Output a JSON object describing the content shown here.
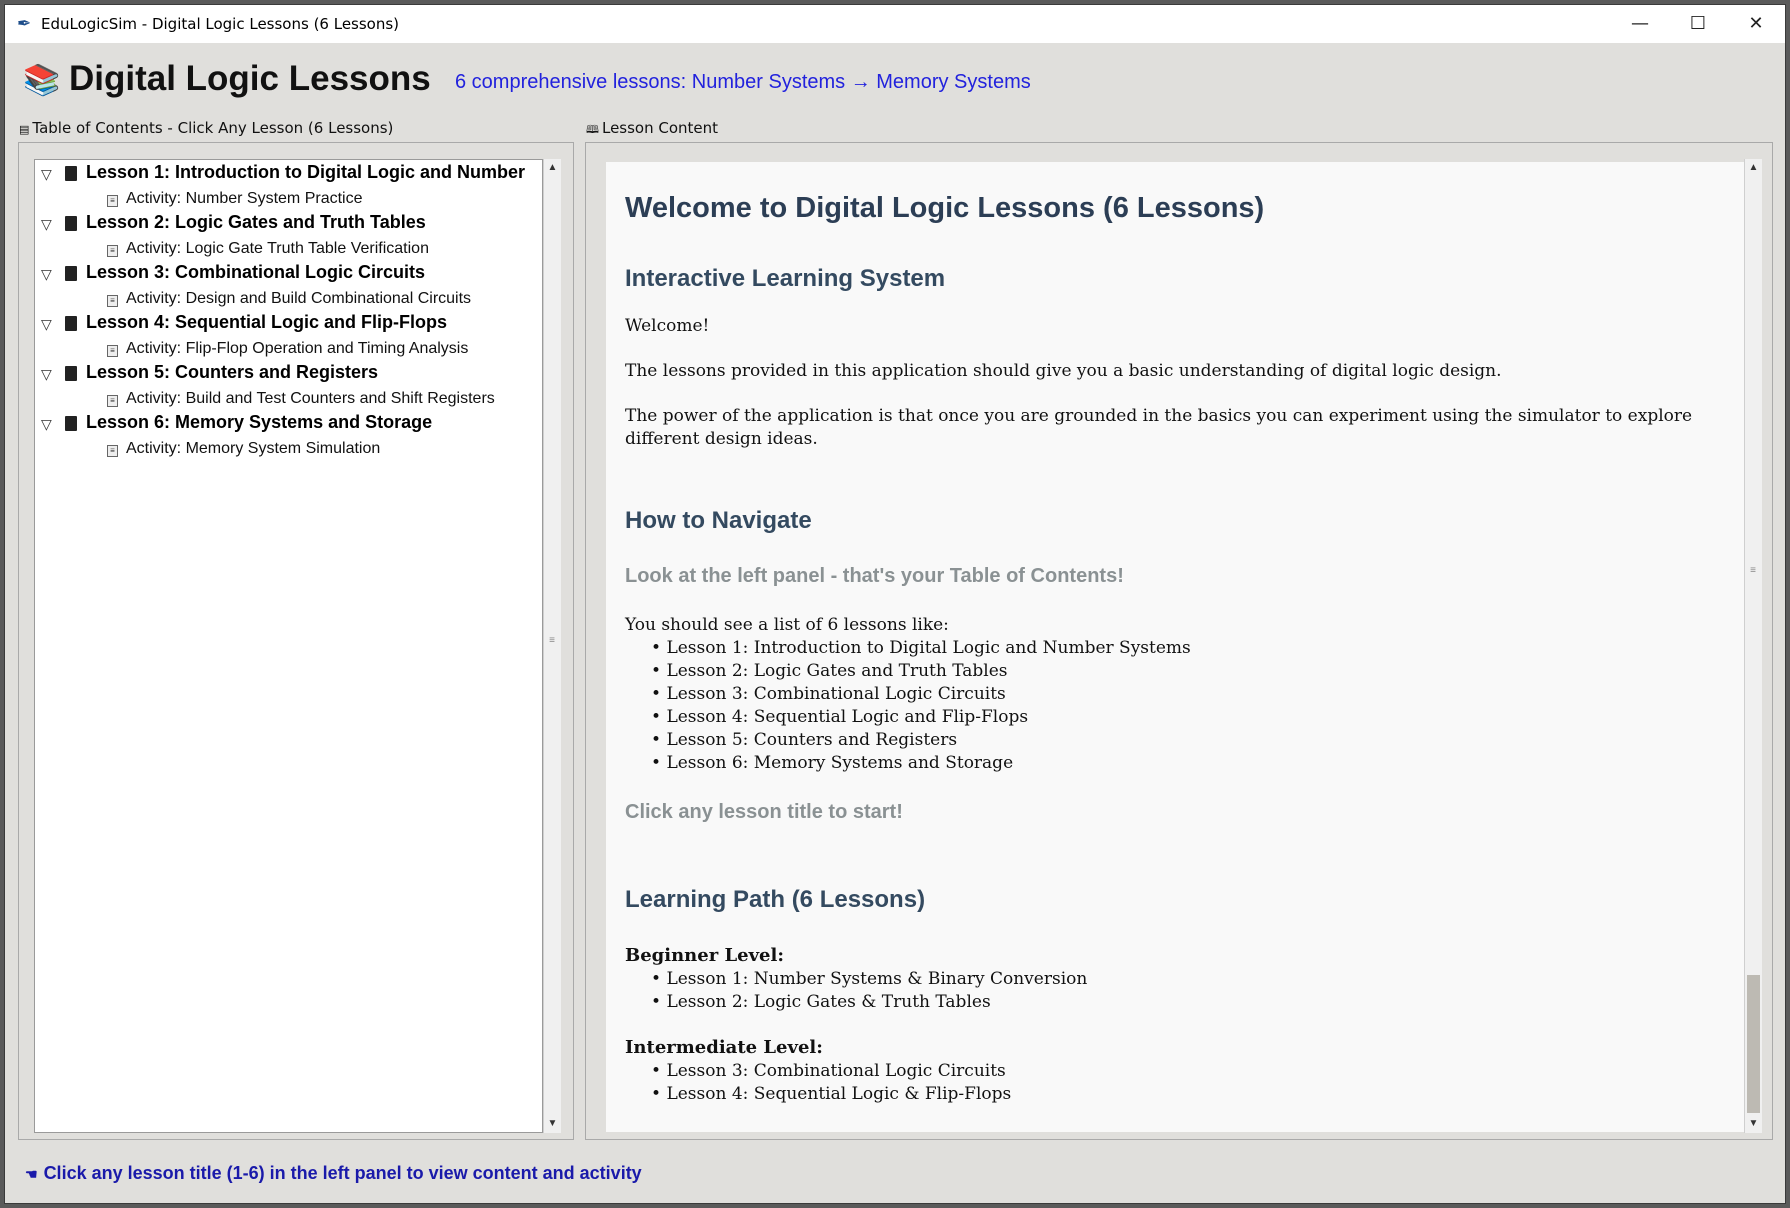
{
  "window": {
    "title": "EduLogicSim - Digital Logic Lessons (6 Lessons)",
    "minimize": "—",
    "maximize": "☐",
    "close": "✕"
  },
  "header": {
    "title": "Digital Logic Lessons",
    "subtitle": "6 comprehensive lessons: Number Systems → Memory Systems"
  },
  "toc": {
    "label": "Table of Contents - Click Any Lesson (6 Lessons)",
    "lessons": [
      {
        "title": "Lesson 1: Introduction to Digital Logic and Number",
        "activity": "Activity: Number System Practice"
      },
      {
        "title": "Lesson 2: Logic Gates and Truth Tables",
        "activity": "Activity: Logic Gate Truth Table Verification"
      },
      {
        "title": "Lesson 3: Combinational Logic Circuits",
        "activity": "Activity: Design and Build Combinational Circuits"
      },
      {
        "title": "Lesson 4: Sequential Logic and Flip-Flops",
        "activity": "Activity: Flip-Flop Operation and Timing Analysis"
      },
      {
        "title": "Lesson 5: Counters and Registers",
        "activity": "Activity: Build and Test Counters and Shift Registers"
      },
      {
        "title": "Lesson 6: Memory Systems and Storage",
        "activity": "Activity: Memory System Simulation"
      }
    ]
  },
  "content": {
    "label": "Lesson Content",
    "heading": "Welcome to Digital Logic Lessons (6 Lessons)",
    "section1_title": "Interactive Learning System",
    "welcome": "Welcome!",
    "para1": "The lessons provided in this application should give you a basic understanding of digital logic design.",
    "para2": "The power of the application is that once you are grounded in the basics you can experiment using the simulator to explore different design ideas.",
    "section2_title": "How to Navigate",
    "nav_hint": "Look at the left panel - that's your Table of Contents!",
    "list_intro": "You should see a list of 6 lessons like:",
    "lesson_list": [
      "Lesson 1: Introduction to Digital Logic and Number Systems",
      "Lesson 2: Logic Gates and Truth Tables",
      "Lesson 3: Combinational Logic Circuits",
      "Lesson 4: Sequential Logic and Flip-Flops",
      "Lesson 5: Counters and Registers",
      "Lesson 6: Memory Systems and Storage"
    ],
    "start_hint": "Click any lesson title to start!",
    "section3_title": "Learning Path (6 Lessons)",
    "beginner_label": "Beginner Level:",
    "beginner_items": [
      "Lesson 1: Number Systems & Binary Conversion",
      "Lesson 2: Logic Gates & Truth Tables"
    ],
    "intermediate_label": "Intermediate Level:",
    "intermediate_items": [
      "Lesson 3: Combinational Logic Circuits",
      "Lesson 4: Sequential Logic & Flip-Flops"
    ]
  },
  "status": {
    "text": "Click any lesson title (1-6) in the left panel to view content and activity"
  },
  "colors": {
    "subtitle": "#2222dd",
    "status": "#1a1aaa",
    "heading": "#2c3e55"
  }
}
